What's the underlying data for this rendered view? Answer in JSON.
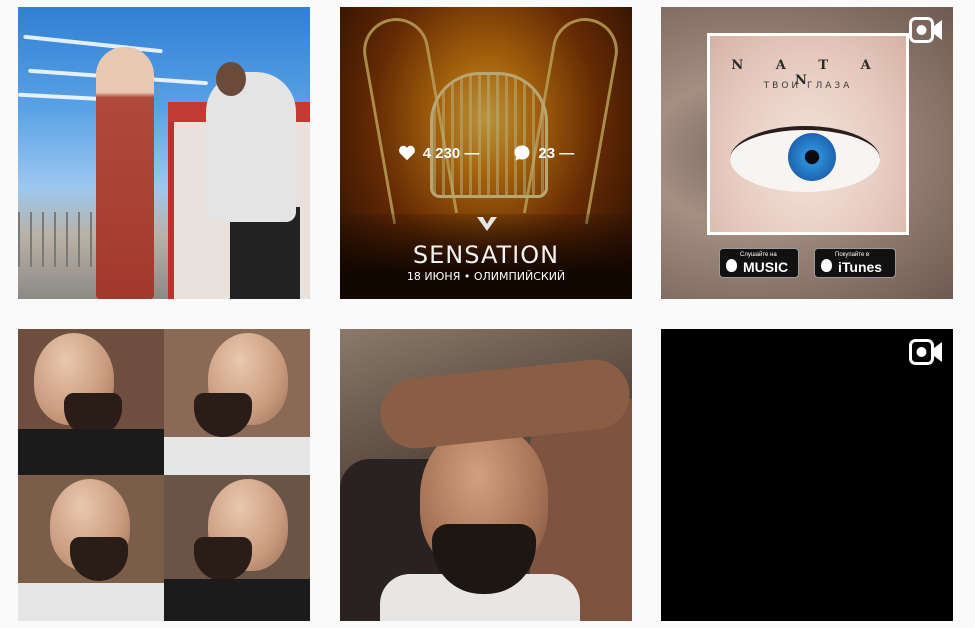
{
  "posts": [
    {
      "id_label": "photo-outdoor"
    },
    {
      "likes": "4 230 —",
      "comments": "23 —",
      "image_text": {
        "title": "SENSATION",
        "subtitle": "18 ИЮНЯ • ОЛИМПИЙСКИЙ"
      }
    },
    {
      "type": "video",
      "image_text": {
        "artist": "N A T A N",
        "song": "ТВОИ ГЛАЗА",
        "badge_music_small": "Слушайте на",
        "badge_music": "MUSIC",
        "badge_itunes_small": "Покупайте в",
        "badge_itunes": "iTunes"
      }
    },
    {
      "id_label": "barber-collage"
    },
    {
      "id_label": "selfie"
    },
    {
      "type": "video"
    }
  ],
  "icons": {
    "video": "video-camera-icon",
    "likes": "heart-icon",
    "comments": "comment-bubble-icon"
  },
  "colors": {
    "overlay_text": "#ffffff",
    "background": "#fafafa"
  }
}
